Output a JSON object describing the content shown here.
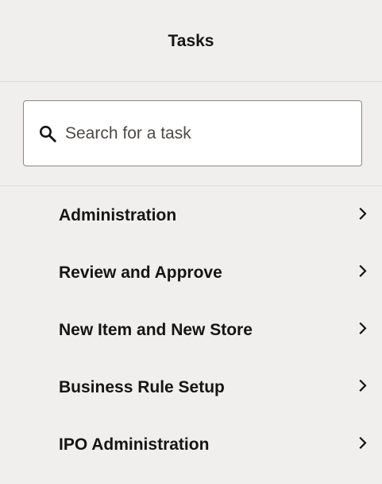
{
  "panel": {
    "title": "Tasks"
  },
  "search": {
    "placeholder": "Search for a task",
    "value": "",
    "icon": "search-icon"
  },
  "tasks": [
    {
      "label": "Administration",
      "icon": "chevron-right-icon"
    },
    {
      "label": "Review and Approve",
      "icon": "chevron-right-icon"
    },
    {
      "label": "New Item and New Store",
      "icon": "chevron-right-icon"
    },
    {
      "label": "Business Rule Setup",
      "icon": "chevron-right-icon"
    },
    {
      "label": "IPO Administration",
      "icon": "chevron-right-icon"
    }
  ],
  "colors": {
    "panel_background": "#f1efed",
    "text": "#161513",
    "border": "#8c8985",
    "divider": "#dedad6"
  }
}
